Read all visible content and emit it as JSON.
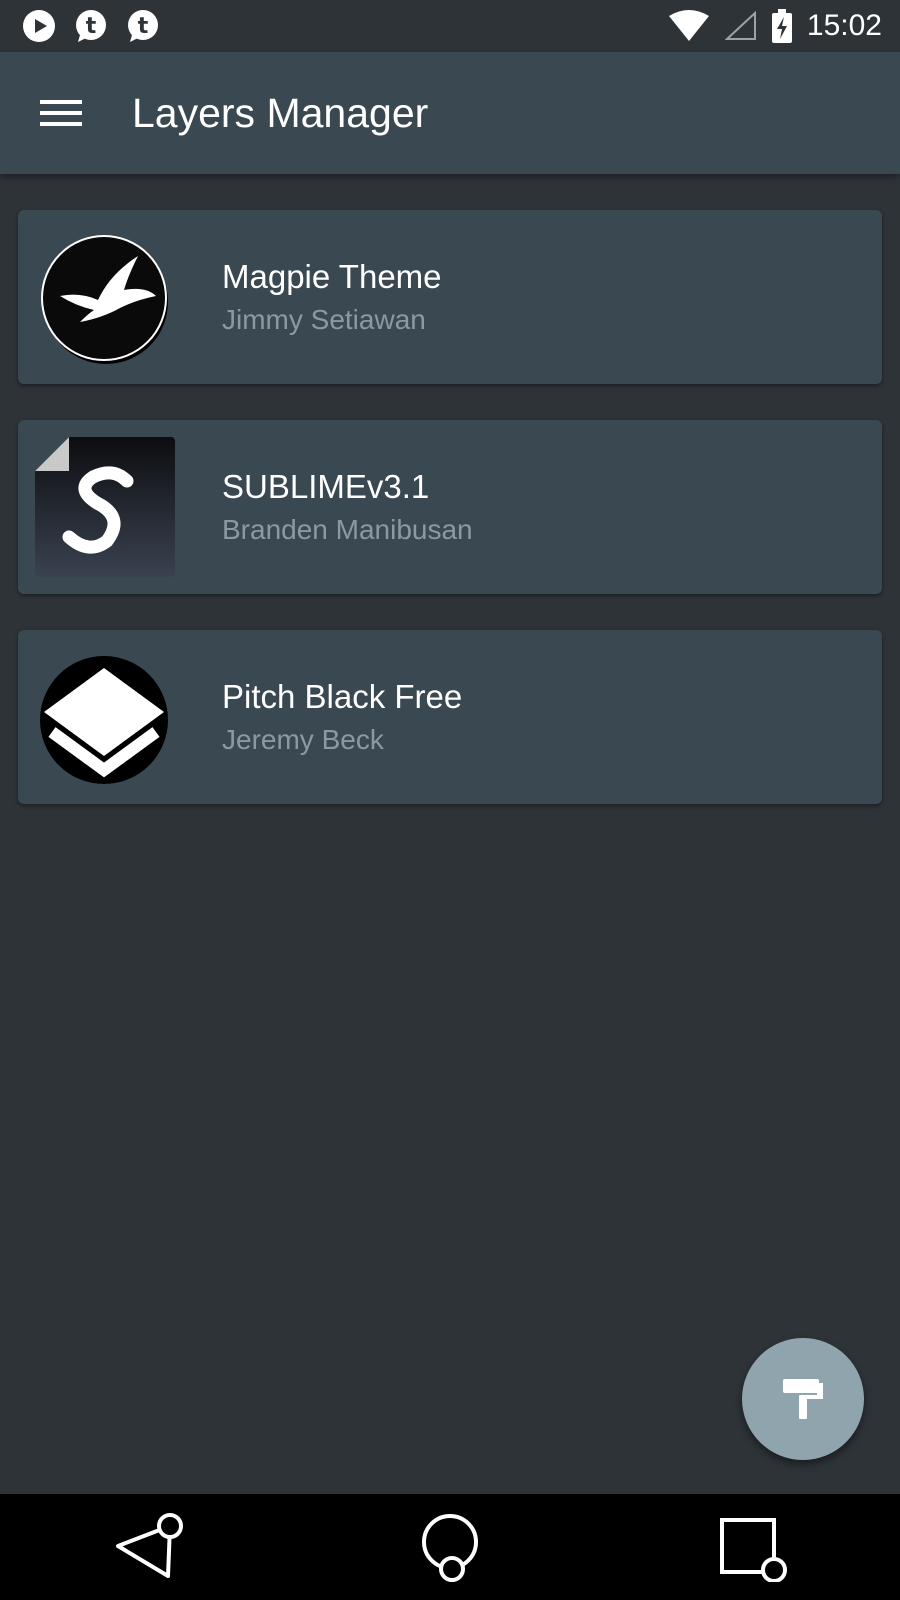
{
  "status_bar": {
    "notifications": [
      "play-icon",
      "tumblr-icon",
      "tumblr-icon"
    ],
    "time": "15:02"
  },
  "app_bar": {
    "title": "Layers Manager"
  },
  "themes": [
    {
      "title": "Magpie Theme",
      "author": "Jimmy Setiawan",
      "icon": "magpie-bird-icon"
    },
    {
      "title": "SUBLIMEv3.1",
      "author": "Branden Manibusan",
      "icon": "sublime-s-icon"
    },
    {
      "title": "Pitch Black Free",
      "author": "Jeremy Beck",
      "icon": "layers-icon"
    }
  ],
  "fab": {
    "icon": "paint-roller-icon"
  },
  "colors": {
    "background": "#2e3338",
    "app_bar": "#3a4852",
    "card": "#3a4852",
    "fab": "#90a4ae",
    "subtitle": "#8a9aa3"
  }
}
